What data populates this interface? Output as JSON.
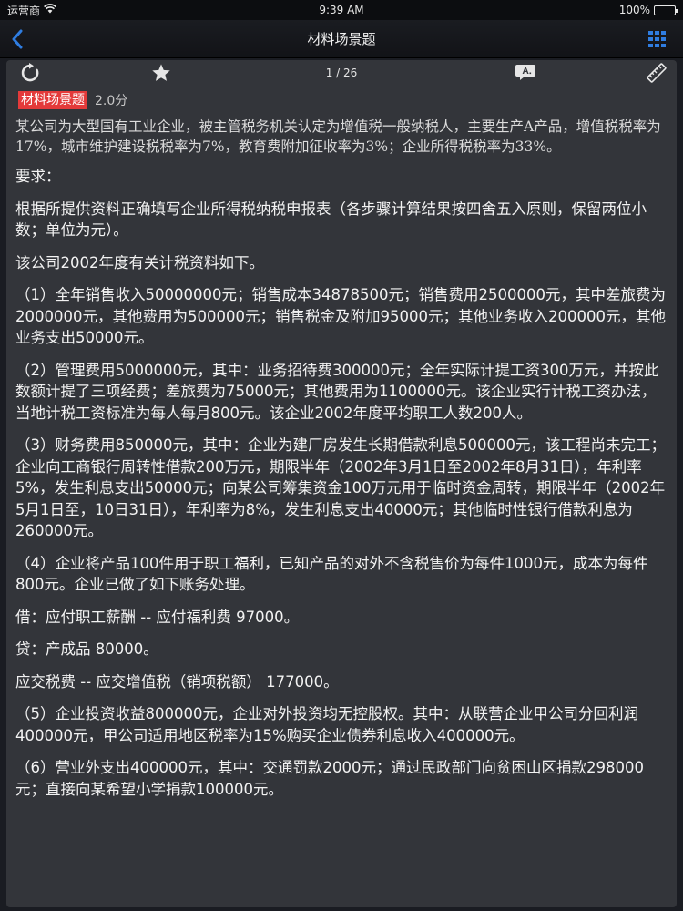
{
  "status": {
    "carrier": "运营商",
    "time": "9:39 AM",
    "battery": "100%",
    "battery_level": 1.0
  },
  "nav": {
    "title": "材料场景题"
  },
  "toolbar": {
    "pager": "1 / 26"
  },
  "question": {
    "tag": "材料场景题",
    "score": "2.0分",
    "intro": "某公司为大型国有工业企业，被主管税务机关认定为增值税一般纳税人，主要生产A产品，增值税税率为17%，城市维护建设税税率为7%，教育费附加征收率为3%；企业所得税税率为33%。",
    "paragraphs": [
      "要求：",
      "根据所提供资料正确填写企业所得税纳税申报表（各步骤计算结果按四舍五入原则，保留两位小数；单位为元）。",
      "该公司2002年度有关计税资料如下。",
      "（1）全年销售收入50000000元；销售成本34878500元；销售费用2500000元，其中差旅费为2000000元，其他费用为500000元；销售税金及附加95000元；其他业务收入200000元，其他业务支出50000元。",
      "（2）管理费用5000000元，其中：业务招待费300000元；全年实际计提工资300万元，并按此数额计提了三项经费；差旅费为75000元；其他费用为1100000元。该企业实行计税工资办法，当地计税工资标准为每人每月800元。该企业2002年度平均职工人数200人。",
      "（3）财务费用850000元，其中：企业为建厂房发生长期借款利息500000元，该工程尚未完工；企业向工商银行周转性借款200万元，期限半年（2002年3月1日至2002年8月31日），年利率5%，发生利息支出50000元；向某公司筹集资金100万元用于临时资金周转，期限半年（2002年5月1日至，10日31日），年利率为8%，发生利息支出40000元；其他临时性银行借款利息为260000元。",
      "（4）企业将产品100件用于职工福利，已知产品的对外不含税售价为每件1000元，成本为每件800元。企业已做了如下账务处理。",
      "借：应付职工薪酬 -- 应付福利费 97000。",
      "贷：产成品 80000。",
      "应交税费 -- 应交增值税（销项税额） 177000。",
      "（5）企业投资收益800000元，企业对外投资均无控股权。其中：从联营企业甲公司分回利润400000元，甲公司适用地区税率为15%购买企业债券利息收入400000元。",
      "（6）营业外支出400000元，其中：交通罚款2000元；通过民政部门向贫困山区捐款298000元；直接向某希望小学捐款100000元。"
    ]
  }
}
